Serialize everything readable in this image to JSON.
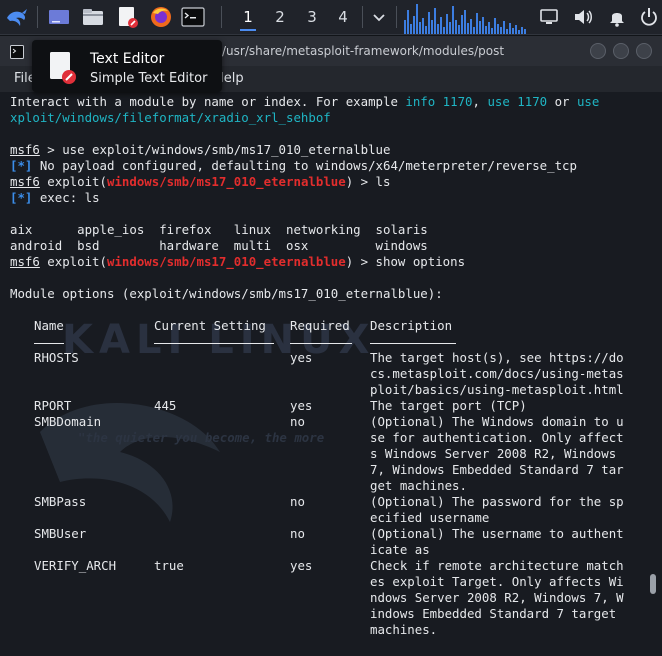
{
  "panel": {
    "workspaces": [
      "1",
      "2",
      "3",
      "4"
    ],
    "icons": [
      "kali-dragon-icon",
      "show-desktop-icon",
      "file-manager-icon",
      "text-editor-icon",
      "firefox-icon",
      "terminal-icon",
      "chevron-down-icon",
      "display-icon",
      "volume-icon",
      "notification-bell-icon",
      "power-icon"
    ]
  },
  "window": {
    "title": "gulraiz@Kali: /usr/share/metasploit-framework/modules/post",
    "menu": [
      "File",
      "Help"
    ]
  },
  "tooltip": {
    "title": "Text Editor",
    "subtitle": "Simple Text Editor"
  },
  "terminal": {
    "line1_a": "Interact with a module by name or index. For example ",
    "line1_info": "info 1170",
    "line1_b": ", ",
    "line1_use": "use 1170",
    "line1_c": " or ",
    "line1_use2": "use",
    "line2": "xploit/windows/fileformat/xradio_xrl_sehbof",
    "prompt": "msf6",
    "cmd_use": " > use exploit/windows/smb/ms17_010_eternalblue",
    "star": "[*]",
    "payload_msg": " No payload configured, defaulting to windows/x64/meterpreter/reverse_tcp",
    "exploit_prefix": " exploit(",
    "module": "windows/smb/ms17_010_eternalblue",
    "cmd_ls": ") > ls",
    "exec_msg": " exec: ls",
    "ls_row1": "aix      apple_ios  firefox   linux  networking  solaris",
    "ls_row2": "android  bsd        hardware  multi  osx         windows",
    "cmd_show": ") > show options",
    "module_options": "Module options (exploit/windows/smb/ms17_010_eternalblue):",
    "headers": [
      "Name",
      "Current Setting",
      "Required",
      "Description"
    ],
    "options": [
      {
        "name": "RHOSTS",
        "setting": "",
        "required": "yes",
        "desc": [
          "The target host(s), see https://do",
          "cs.metasploit.com/docs/using-metas",
          "ploit/basics/using-metasploit.html"
        ]
      },
      {
        "name": "RPORT",
        "setting": "445",
        "required": "yes",
        "desc": [
          "The target port (TCP)"
        ]
      },
      {
        "name": "SMBDomain",
        "setting": "",
        "required": "no",
        "desc": [
          "(Optional) The Windows domain to u",
          "se for authentication. Only affect",
          "s Windows Server 2008 R2, Windows",
          "7, Windows Embedded Standard 7 tar",
          "get machines."
        ]
      },
      {
        "name": "SMBPass",
        "setting": "",
        "required": "no",
        "desc": [
          "(Optional) The password for the sp",
          "ecified username"
        ]
      },
      {
        "name": "SMBUser",
        "setting": "",
        "required": "no",
        "desc": [
          "(Optional) The username to authent",
          "icate as"
        ]
      },
      {
        "name": "VERIFY_ARCH",
        "setting": "true",
        "required": "yes",
        "desc": [
          "Check if remote architecture match",
          "es exploit Target. Only affects Wi",
          "ndows Server 2008 R2, Windows 7, W",
          "indows Embedded Standard 7 target",
          "machines."
        ]
      }
    ],
    "watermark_text": "KALI LINUX",
    "watermark_motto": "\"the quieter you become, the more"
  },
  "colors": {
    "panel_bg": "#20232a",
    "terminal_bg": "#181b21",
    "prompt_red": "#e22d2d",
    "info_blue": "#3b8eea",
    "link_cyan": "#1fb5c4"
  }
}
